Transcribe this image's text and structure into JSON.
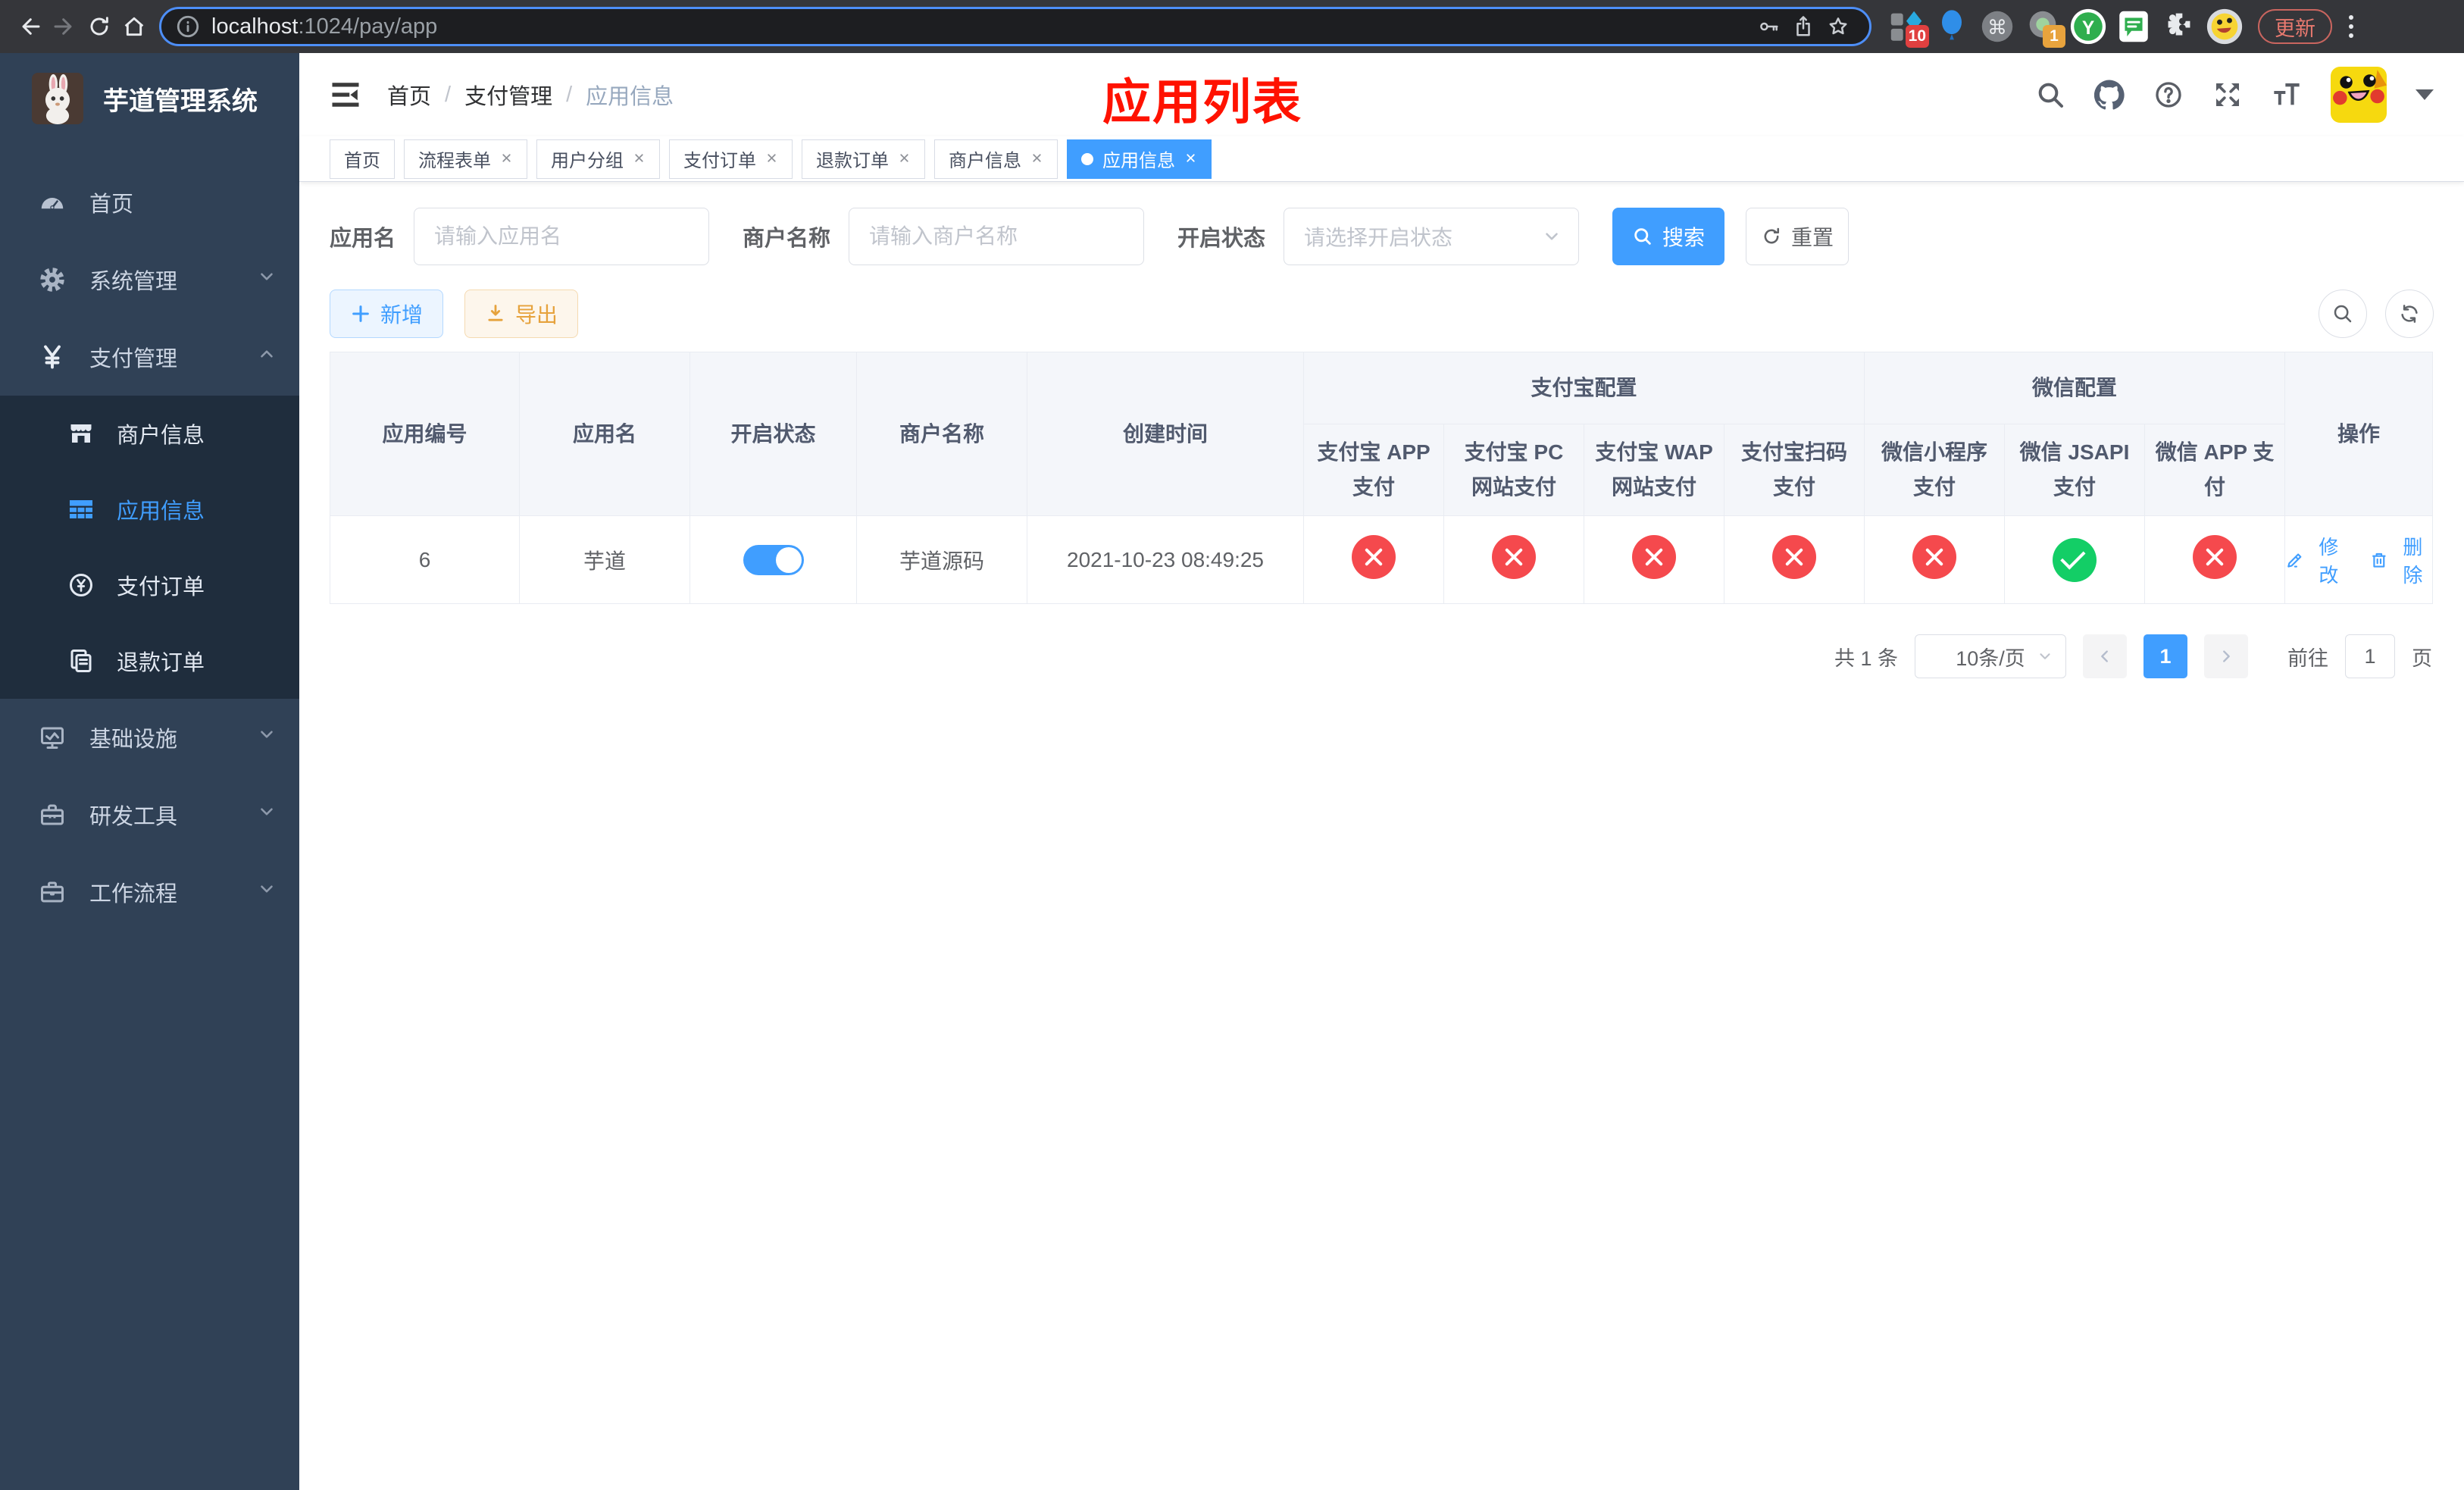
{
  "colors": {
    "accent": "#409EFF",
    "danger": "#f5494d",
    "success": "#13ce66",
    "warning": "#e6a23c",
    "sidebar_bg": "#304156",
    "submenu_bg": "#1f2d3d"
  },
  "browser": {
    "url_host": "localhost",
    "url_path": ":1024/pay/app",
    "ext_badge_blue": "10",
    "ext_badge_tab": "1",
    "ext_y_label": "Y",
    "ext_cmd_glyph": "⌘",
    "update_label": "更新"
  },
  "sidebar": {
    "title": "芋道管理系统",
    "menu": [
      {
        "label": "首页"
      },
      {
        "label": "系统管理"
      },
      {
        "label": "支付管理"
      },
      {
        "label": "基础设施"
      },
      {
        "label": "研发工具"
      },
      {
        "label": "工作流程"
      }
    ],
    "submenu": [
      {
        "label": "商户信息"
      },
      {
        "label": "应用信息"
      },
      {
        "label": "支付订单"
      },
      {
        "label": "退款订单"
      }
    ]
  },
  "navbar": {
    "breadcrumb": [
      "首页",
      "支付管理",
      "应用信息"
    ],
    "annotation": "应用列表"
  },
  "tabs": [
    {
      "label": "首页"
    },
    {
      "label": "流程表单"
    },
    {
      "label": "用户分组"
    },
    {
      "label": "支付订单"
    },
    {
      "label": "退款订单"
    },
    {
      "label": "商户信息"
    },
    {
      "label": "应用信息"
    }
  ],
  "filters": {
    "app_name_label": "应用名",
    "app_name_placeholder": "请输入应用名",
    "merchant_label": "商户名称",
    "merchant_placeholder": "请输入商户名称",
    "status_label": "开启状态",
    "status_placeholder": "请选择开启状态",
    "search_label": "搜索",
    "reset_label": "重置"
  },
  "toolbar": {
    "add_label": "新增",
    "export_label": "导出"
  },
  "table": {
    "columns": {
      "id": "应用编号",
      "name": "应用名",
      "status": "开启状态",
      "merchant": "商户名称",
      "created": "创建时间",
      "ops": "操作"
    },
    "groups": {
      "alipay": "支付宝配置",
      "wechat": "微信配置"
    },
    "channels": [
      "支付宝 APP 支付",
      "支付宝 PC 网站支付",
      "支付宝 WAP 网站支付",
      "支付宝扫码支付",
      "微信小程序支付",
      "微信 JSAPI 支付",
      "微信 APP 支付"
    ],
    "row": {
      "id": "6",
      "name": "芋道",
      "enabled": true,
      "merchant": "芋道源码",
      "created": "2021-10-23 08:49:25",
      "channel_enabled": [
        false,
        false,
        false,
        false,
        false,
        true,
        false
      ],
      "edit_label": "修改",
      "delete_label": "删除"
    }
  },
  "pagination": {
    "total": "共 1 条",
    "per_page": "10条/页",
    "page": "1",
    "goto_label": "前往",
    "goto_value": "1",
    "page_unit": "页"
  }
}
